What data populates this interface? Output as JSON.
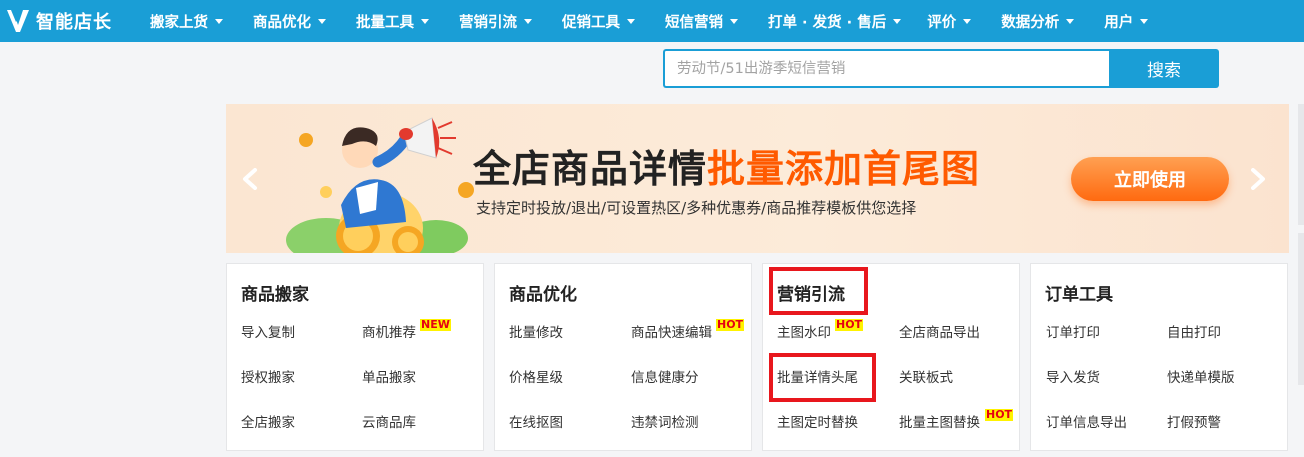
{
  "brand": {
    "name": "智能店长"
  },
  "nav": {
    "items": [
      {
        "label": "搬家上货"
      },
      {
        "label": "商品优化"
      },
      {
        "label": "批量工具"
      },
      {
        "label": "营销引流"
      },
      {
        "label": "促销工具"
      },
      {
        "label": "短信营销"
      },
      {
        "label": "打单 · 发货 · 售后"
      },
      {
        "label": "评价"
      },
      {
        "label": "数据分析"
      },
      {
        "label": "用户"
      }
    ]
  },
  "search": {
    "placeholder": "劳动节/51出游季短信营销",
    "button_label": "搜索"
  },
  "banner": {
    "title_black": "全店商品详情",
    "title_orange": "批量添加首尾图",
    "subtitle": "支持定时投放/退出/可设置热区/多种优惠券/商品推荐模板供您选择",
    "cta_label": "立即使用"
  },
  "cards": [
    {
      "title": "商品搬家",
      "links": [
        {
          "label": "导入复制"
        },
        {
          "label": "商机推荐",
          "tag": "NEW"
        },
        {
          "label": "授权搬家"
        },
        {
          "label": "单品搬家"
        },
        {
          "label": "全店搬家"
        },
        {
          "label": "云商品库"
        }
      ]
    },
    {
      "title": "商品优化",
      "links": [
        {
          "label": "批量修改"
        },
        {
          "label": "商品快速编辑",
          "tag": "HOT"
        },
        {
          "label": "价格星级"
        },
        {
          "label": "信息健康分"
        },
        {
          "label": "在线抠图"
        },
        {
          "label": "违禁词检测"
        }
      ]
    },
    {
      "title": "营销引流",
      "links": [
        {
          "label": "主图水印",
          "tag": "HOT"
        },
        {
          "label": "全店商品导出"
        },
        {
          "label": "批量详情头尾"
        },
        {
          "label": "关联板式"
        },
        {
          "label": "主图定时替换"
        },
        {
          "label": "批量主图替换",
          "tag": "HOT"
        }
      ]
    },
    {
      "title": "订单工具",
      "links": [
        {
          "label": "订单打印"
        },
        {
          "label": "自由打印"
        },
        {
          "label": "导入发货"
        },
        {
          "label": "快递单模版"
        },
        {
          "label": "订单信息导出"
        },
        {
          "label": "打假预警"
        }
      ]
    }
  ],
  "colors": {
    "nav_bg": "#1a9ed6",
    "accent_orange": "#ff5a00",
    "highlight_red": "#e8171d",
    "hot_tag_bg": "#fff200"
  }
}
